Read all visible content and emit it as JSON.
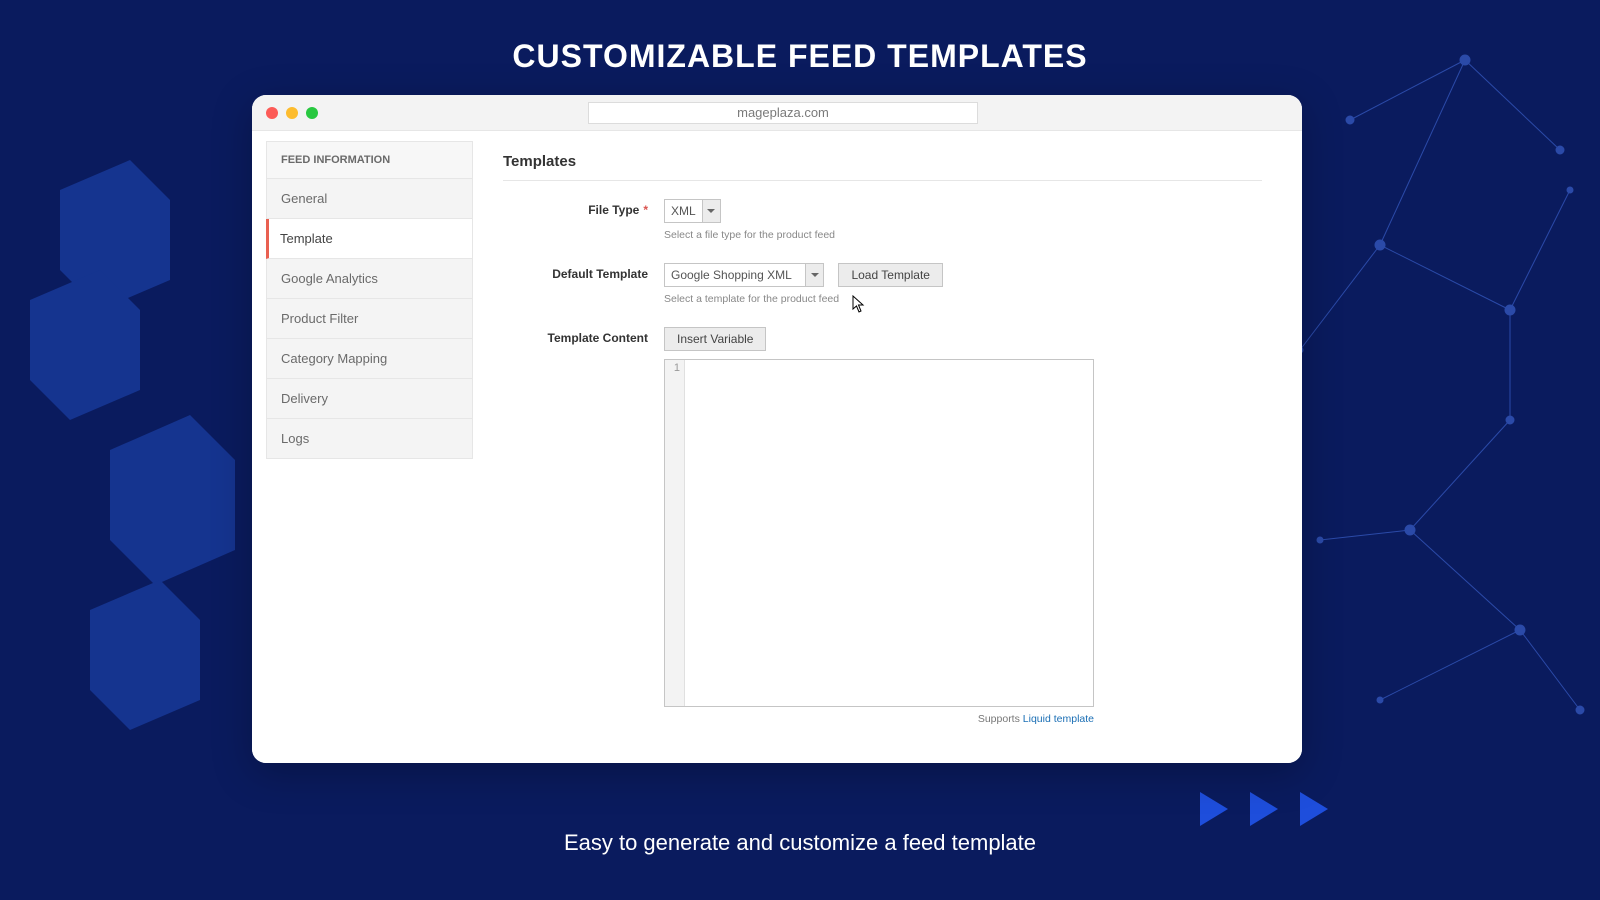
{
  "hero": {
    "title": "CUSTOMIZABLE FEED TEMPLATES",
    "subtitle": "Easy to generate and customize a feed template"
  },
  "browser": {
    "url": "mageplaza.com"
  },
  "sidebar": {
    "header": "FEED INFORMATION",
    "items": [
      {
        "label": "General",
        "active": false
      },
      {
        "label": "Template",
        "active": true
      },
      {
        "label": "Google Analytics",
        "active": false
      },
      {
        "label": "Product Filter",
        "active": false
      },
      {
        "label": "Category Mapping",
        "active": false
      },
      {
        "label": "Delivery",
        "active": false
      },
      {
        "label": "Logs",
        "active": false
      }
    ]
  },
  "form": {
    "section": "Templates",
    "file_type_label": "File Type",
    "file_type_value": "XML",
    "file_type_help": "Select a file type for the product feed",
    "default_template_label": "Default Template",
    "default_template_value": "Google Shopping XML",
    "default_template_help": "Select a template for the product feed",
    "load_template_btn": "Load Template",
    "template_content_label": "Template Content",
    "insert_variable_btn": "Insert Variable",
    "line_no": "1",
    "supports_text": "Supports ",
    "supports_link": "Liquid template"
  }
}
